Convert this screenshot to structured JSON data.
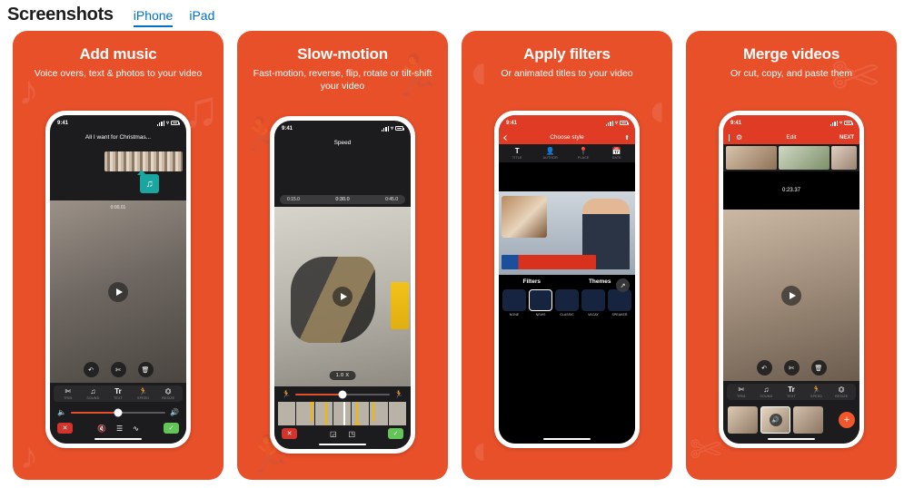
{
  "header": {
    "title": "Screenshots",
    "tabs": [
      {
        "label": "iPhone",
        "active": true
      },
      {
        "label": "iPad",
        "active": false
      }
    ]
  },
  "cards": [
    {
      "id": "add-music",
      "title": "Add music",
      "subtitle": "Voice overs, text & photos to your video",
      "watermark": "music-note-icon",
      "phone": {
        "status_time": "9:41",
        "nav_title": "All I want for Christmas...",
        "badge_icon": "music-note-icon",
        "overlay_buttons": [
          "undo-icon",
          "scissors-icon",
          "trash-icon"
        ],
        "toolbar": [
          {
            "icon": "scissors-icon",
            "label": "TRIM"
          },
          {
            "icon": "music-note-icon",
            "label": "SOUND"
          },
          {
            "icon": "text-icon",
            "label": "TEXT"
          },
          {
            "icon": "speed-icon",
            "label": "SPEED"
          },
          {
            "icon": "crop-icon",
            "label": "RESIZE"
          }
        ],
        "volume_left_icon": "volume-low-icon",
        "volume_right_icon": "volume-high-icon",
        "actions": [
          "cancel-icon",
          "mute-icon",
          "waveform-icon",
          "fade-icon",
          "confirm-icon"
        ]
      }
    },
    {
      "id": "slow-motion",
      "title": "Slow-motion",
      "subtitle": "Fast-motion, reverse, flip, rotate or tilt-shift your video",
      "watermark": "runner-icon",
      "phone": {
        "status_time": "9:41",
        "nav_title": "Speed",
        "timeline_marks": [
          "0:15.0",
          "0:30.0",
          "0:45.0"
        ],
        "speed_pill": "1.0 X",
        "slider_left_icon": "walk-icon",
        "slider_right_icon": "run-icon",
        "actions": [
          "cancel-icon",
          "split-left-icon",
          "split-right-icon",
          "confirm-icon"
        ]
      }
    },
    {
      "id": "apply-filters",
      "title": "Apply filters",
      "subtitle": "Or animated titles to your video",
      "watermark": "bubbles-icon",
      "phone": {
        "status_time": "9:41",
        "nav_title": "Choose style",
        "nav_left_icon": "back-chevron-icon",
        "nav_right_icon": "share-icon",
        "tabs": [
          {
            "icon": "title-icon",
            "label": "TITLE"
          },
          {
            "icon": "author-icon",
            "label": "AUTHOR"
          },
          {
            "icon": "place-icon",
            "label": "PLACE"
          },
          {
            "icon": "date-icon",
            "label": "DATE"
          }
        ],
        "expand_icon": "expand-icon",
        "sections": [
          "Filters",
          "Themes"
        ],
        "thumbnails": [
          {
            "label": "NONE",
            "selected": false
          },
          {
            "label": "NEWS",
            "selected": true
          },
          {
            "label": "CLASSIC",
            "selected": false
          },
          {
            "label": "VACAY",
            "selected": false
          },
          {
            "label": "SPEAKER",
            "selected": false
          }
        ]
      }
    },
    {
      "id": "merge-videos",
      "title": "Merge videos",
      "subtitle": "Or cut, copy, and paste them",
      "watermark": "scissors-icon",
      "phone": {
        "status_time": "9:41",
        "nav_title": "Edit",
        "nav_left_icon": "back-chevron-icon",
        "nav_gear_icon": "gear-icon",
        "nav_next_label": "NEXT",
        "timecode": "0:23.37",
        "overlay_buttons": [
          "undo-icon",
          "scissors-icon",
          "trash-icon"
        ],
        "toolbar": [
          {
            "icon": "scissors-icon",
            "label": "TRIM"
          },
          {
            "icon": "music-note-icon",
            "label": "SOUND"
          },
          {
            "icon": "text-icon",
            "label": "TEXT"
          },
          {
            "icon": "speed-icon",
            "label": "SPEED"
          },
          {
            "icon": "crop-icon",
            "label": "RESIZE"
          }
        ],
        "add_clip_label": "+",
        "clip_badge_icon": "volume-icon"
      }
    }
  ],
  "colors": {
    "card_bg": "#e8502a",
    "nav_red": "#e03b24",
    "accent_blue": "#0070c9",
    "confirm_green": "#63c558",
    "cancel_red": "#d0342c",
    "badge_teal": "#1aa6a0",
    "fab_orange": "#f2562a",
    "marker_yellow": "#f2b705"
  }
}
